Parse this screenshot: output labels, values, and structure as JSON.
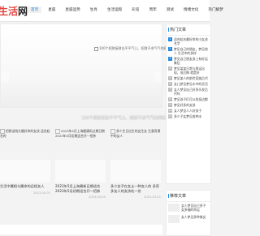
{
  "header": {
    "logo_part1": "生活",
    "logo_part2": "网",
    "nav": [
      "首页",
      "星座",
      "星座运势",
      "生肖",
      "生活运程",
      "彩名",
      "周年",
      "测试",
      "情绪文化",
      "热门解梦"
    ]
  },
  "slider": {
    "image_alt": "100个招财接财出平平气儿、招财不求气气的网络名",
    "caption": "100个招财接财平平气儿、招财不求气气的网络名"
  },
  "picks": [
    {
      "thumb_alt": "",
      "title": "招财送钱头最好命的女孩 适合起名的"
    },
    {
      "thumb_alt": "",
      "title": "2023年5月上海健康码过期日期 2023年5月初期适合开一招券"
    },
    {
      "thumb_alt": "",
      "title": "多少生日出生的女生女 生意奇景中的女人"
    }
  ],
  "cards": [
    {
      "title": "生活中属相与属命的运程女人",
      "meta_left": "",
      "date": "2023-05-01"
    },
    {
      "title": "2023年5月上海最新日期适合 2023年5月初期适合开一招券",
      "meta_left": "",
      "date": "2023-04-04"
    },
    {
      "title": "多少女子在女士一种女人的 多奇多女人的女孩吃一份",
      "meta_left": "",
      "date": "2023-03-21"
    }
  ],
  "sidebar": {
    "hot_title": "热门文章",
    "hot_items": [
      "适合起名最好命的小女孩名字",
      "梦见自己的朋友，梦见他人 生活中的多样",
      "梦见自己朋友身上有好运象征",
      "梦见某某日常与财运出现，但后悔 就是好",
      "梦见某人的前世家族后代",
      "女儿梦见梦见水中的灵活",
      "女人梦见自己好多头发后代吗",
      "梦见孩子们可以的身边都",
      "梦见好多的女孩",
      "女人梦见人人好孩子",
      "多少子女梦见各种水"
    ],
    "rec_title": "推荐文章",
    "rec_items": [
      "女人梦见自己多子女多福的命运",
      "女人梦见多种美女"
    ]
  },
  "colors": {
    "accent": "#1e88e5",
    "logo_red": "#e0443e"
  }
}
